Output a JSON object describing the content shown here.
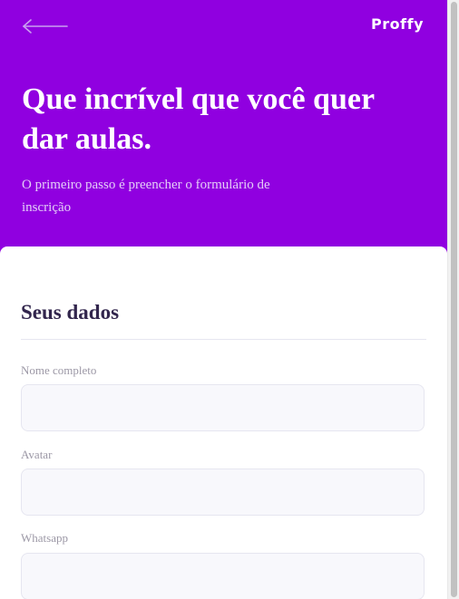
{
  "header": {
    "back_icon": "arrow-left-icon",
    "logo_text": "Proffy"
  },
  "hero": {
    "title": "Que incrível que você quer dar aulas.",
    "description": "O primeiro passo é preencher o formulário de inscrição"
  },
  "form": {
    "section_title": "Seus dados",
    "fields": [
      {
        "label": "Nome completo",
        "value": ""
      },
      {
        "label": "Avatar",
        "value": ""
      },
      {
        "label": "Whatsapp",
        "value": ""
      }
    ]
  },
  "colors": {
    "primary": "#9000e0",
    "text_title": "#32264d",
    "text_label": "#9c98a6",
    "input_bg": "#f8f8fc",
    "input_border": "#e6e6f0"
  }
}
